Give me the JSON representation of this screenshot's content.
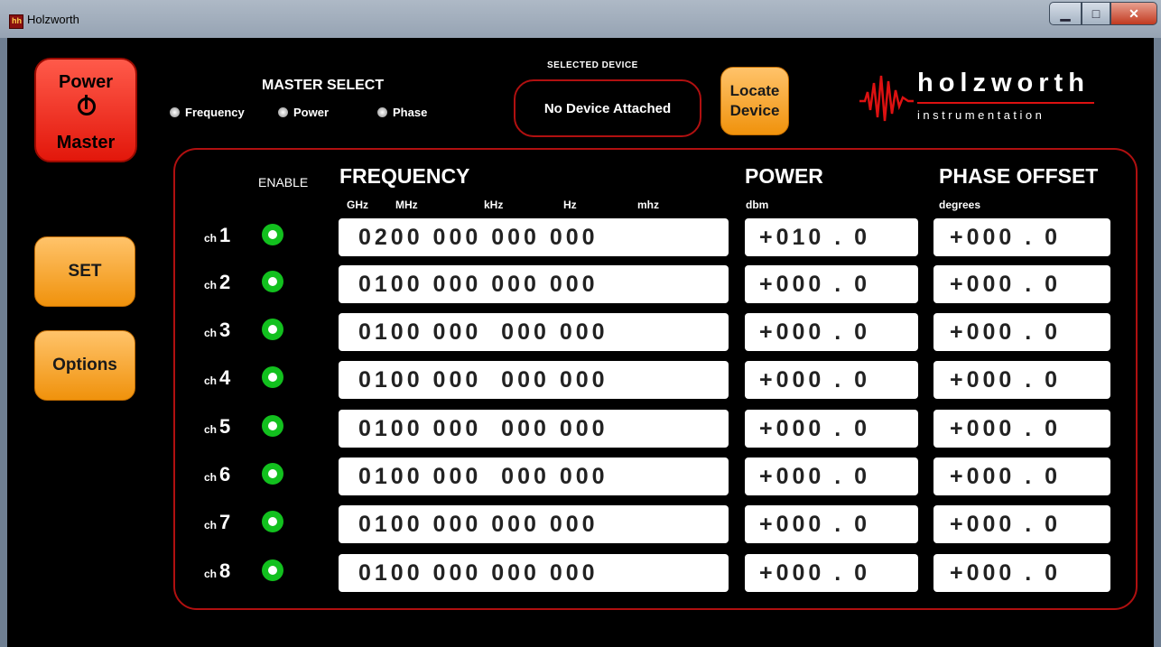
{
  "window": {
    "title": "Holzworth",
    "icon": "holzworth-app-icon"
  },
  "power_master": {
    "line1": "Power",
    "line2": "Master"
  },
  "master_select": {
    "title": "MASTER SELECT",
    "options": [
      "Frequency",
      "Power",
      "Phase"
    ]
  },
  "selected_device": {
    "label": "SELECTED DEVICE",
    "value": "No Device Attached"
  },
  "locate_button": {
    "line1": "Locate",
    "line2": "Device"
  },
  "logo": {
    "name": "holzworth",
    "tagline": "instrumentation"
  },
  "buttons": {
    "set": "SET",
    "options": "Options"
  },
  "headers": {
    "enable": "ENABLE",
    "frequency": "FREQUENCY",
    "power": "POWER",
    "phase": "PHASE OFFSET"
  },
  "units": {
    "ghz": "GHz",
    "mhz": "MHz",
    "khz": "kHz",
    "hz": "Hz",
    "mhz_low": "mhz",
    "dbm": "dbm",
    "degrees": "degrees"
  },
  "ch_prefix": "ch",
  "channels": [
    {
      "num": "1",
      "freq": "0200 000 000 000",
      "power": "+010 . 0",
      "phase": "+000 . 0"
    },
    {
      "num": "2",
      "freq": "0100 000 000 000",
      "power": "+000 . 0",
      "phase": "+000 . 0"
    },
    {
      "num": "3",
      "freq": "0100 000  000 000",
      "power": "+000 . 0",
      "phase": "+000 . 0"
    },
    {
      "num": "4",
      "freq": "0100 000  000 000",
      "power": "+000 . 0",
      "phase": "+000 . 0"
    },
    {
      "num": "5",
      "freq": "0100 000  000 000",
      "power": "+000 . 0",
      "phase": "+000 . 0"
    },
    {
      "num": "6",
      "freq": "0100 000  000 000",
      "power": "+000 . 0",
      "phase": "+000 . 0"
    },
    {
      "num": "7",
      "freq": "0100 000 000 000",
      "power": "+000 . 0",
      "phase": "+000 . 0"
    },
    {
      "num": "8",
      "freq": "0100 000 000 000",
      "power": "+000 . 0",
      "phase": "+000 . 0"
    }
  ],
  "colors": {
    "accent_red": "#b01010",
    "button_orange": "#f0920c",
    "enable_green": "#12c01e"
  }
}
